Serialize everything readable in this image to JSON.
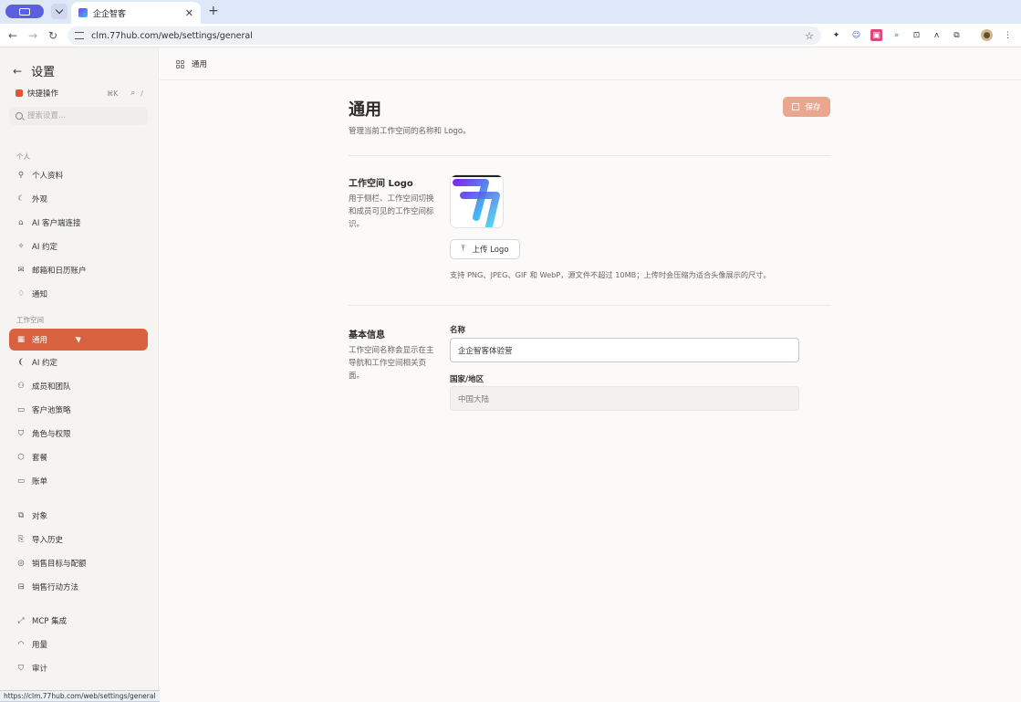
{
  "browser": {
    "tab_title": "企企智客",
    "url": "clm.77hub.com/web/settings/general",
    "status_url": "https://clm.77hub.com/web/settings/general"
  },
  "sidebar": {
    "title": "设置",
    "quick_action_label": "快捷操作",
    "quick_action_shortcut": "⌘K",
    "quick_slash": "/",
    "search_placeholder": "搜索设置...",
    "personal_group": "个人",
    "personal_items": [
      {
        "label": "个人资料",
        "icon": "user-icon"
      },
      {
        "label": "外观",
        "icon": "moon-icon"
      },
      {
        "label": "AI 客户端连接",
        "icon": "ai-client-icon"
      },
      {
        "label": "AI 约定",
        "icon": "sparkle-icon"
      },
      {
        "label": "邮箱和日历账户",
        "icon": "mail-icon"
      },
      {
        "label": "通知",
        "icon": "bell-icon"
      }
    ],
    "workspace_group": "工作空间",
    "workspace_items": [
      {
        "label": "通用",
        "icon": "grid-icon",
        "active": true
      },
      {
        "label": "AI 约定",
        "icon": "ai-rules-icon"
      },
      {
        "label": "成员和团队",
        "icon": "team-icon"
      },
      {
        "label": "客户池策略",
        "icon": "archive-icon"
      },
      {
        "label": "角色与权限",
        "icon": "shield-icon"
      },
      {
        "label": "套餐",
        "icon": "package-icon"
      },
      {
        "label": "账单",
        "icon": "card-icon"
      }
    ],
    "data_items": [
      {
        "label": "对象",
        "icon": "objects-icon"
      },
      {
        "label": "导入历史",
        "icon": "import-icon"
      },
      {
        "label": "销售目标与配额",
        "icon": "target-icon"
      },
      {
        "label": "销售行动方法",
        "icon": "book-icon"
      }
    ],
    "other_items": [
      {
        "label": "MCP 集成",
        "icon": "mcp-icon"
      },
      {
        "label": "用量",
        "icon": "gauge-icon"
      },
      {
        "label": "审计",
        "icon": "audit-icon"
      }
    ]
  },
  "main": {
    "breadcrumb": "通用",
    "title": "通用",
    "subtitle": "管理当前工作空间的名称和 Logo。",
    "save_label": "保存",
    "logo_section": {
      "title": "工作空间 Logo",
      "description": "用于侧栏、工作空间切换和成员可见的工作空间标识。",
      "upload_label": "上传 Logo",
      "hint": "支持 PNG、JPEG、GIF 和 WebP，源文件不超过 10MB；上传时会压缩为适合头像展示的尺寸。"
    },
    "basic_section": {
      "title": "基本信息",
      "description": "工作空间名称会显示在主导航和工作空间相关页面。",
      "name_label": "名称",
      "name_value": "企企智客体验营",
      "country_label": "国家/地区",
      "country_value": "中国大陆"
    }
  },
  "colors": {
    "accent": "#d8623f",
    "save_button": "#eaa68f",
    "sidebar_bg": "#f5f4f1",
    "page_bg": "#fbfaf8"
  }
}
